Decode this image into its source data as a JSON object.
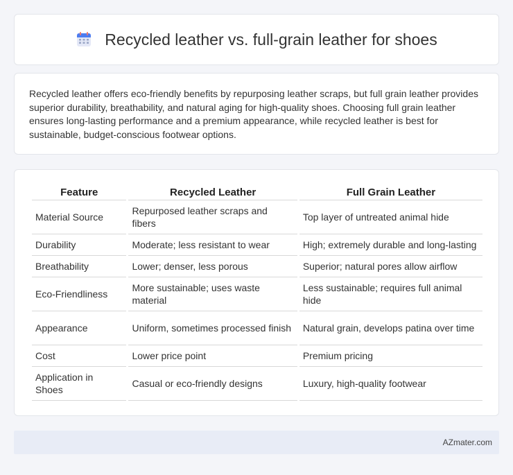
{
  "header": {
    "title": "Recycled leather vs. full-grain leather for shoes",
    "icon": "calendar-icon"
  },
  "intro": {
    "text": "Recycled leather offers eco-friendly benefits by repurposing leather scraps, but full grain leather provides superior durability, breathability, and natural aging for high-quality shoes. Choosing full grain leather ensures long-lasting performance and a premium appearance, while recycled leather is best for sustainable, budget-conscious footwear options."
  },
  "table": {
    "headers": [
      "Feature",
      "Recycled Leather",
      "Full Grain Leather"
    ],
    "rows": [
      [
        "Material Source",
        "Repurposed leather scraps and fibers",
        "Top layer of untreated animal hide"
      ],
      [
        "Durability",
        "Moderate; less resistant to wear",
        "High; extremely durable and long-lasting"
      ],
      [
        "Breathability",
        "Lower; denser, less porous",
        "Superior; natural pores allow airflow"
      ],
      [
        "Eco-Friendliness",
        "More sustainable; uses waste material",
        "Less sustainable; requires full animal hide"
      ],
      [
        "Appearance",
        "Uniform, sometimes processed finish",
        "Natural grain, develops patina over time"
      ],
      [
        "Cost",
        "Lower price point",
        "Premium pricing"
      ],
      [
        "Application in Shoes",
        "Casual or eco-friendly designs",
        "Luxury, high-quality footwear"
      ]
    ]
  },
  "footer": {
    "brand": "AZmater.com"
  }
}
